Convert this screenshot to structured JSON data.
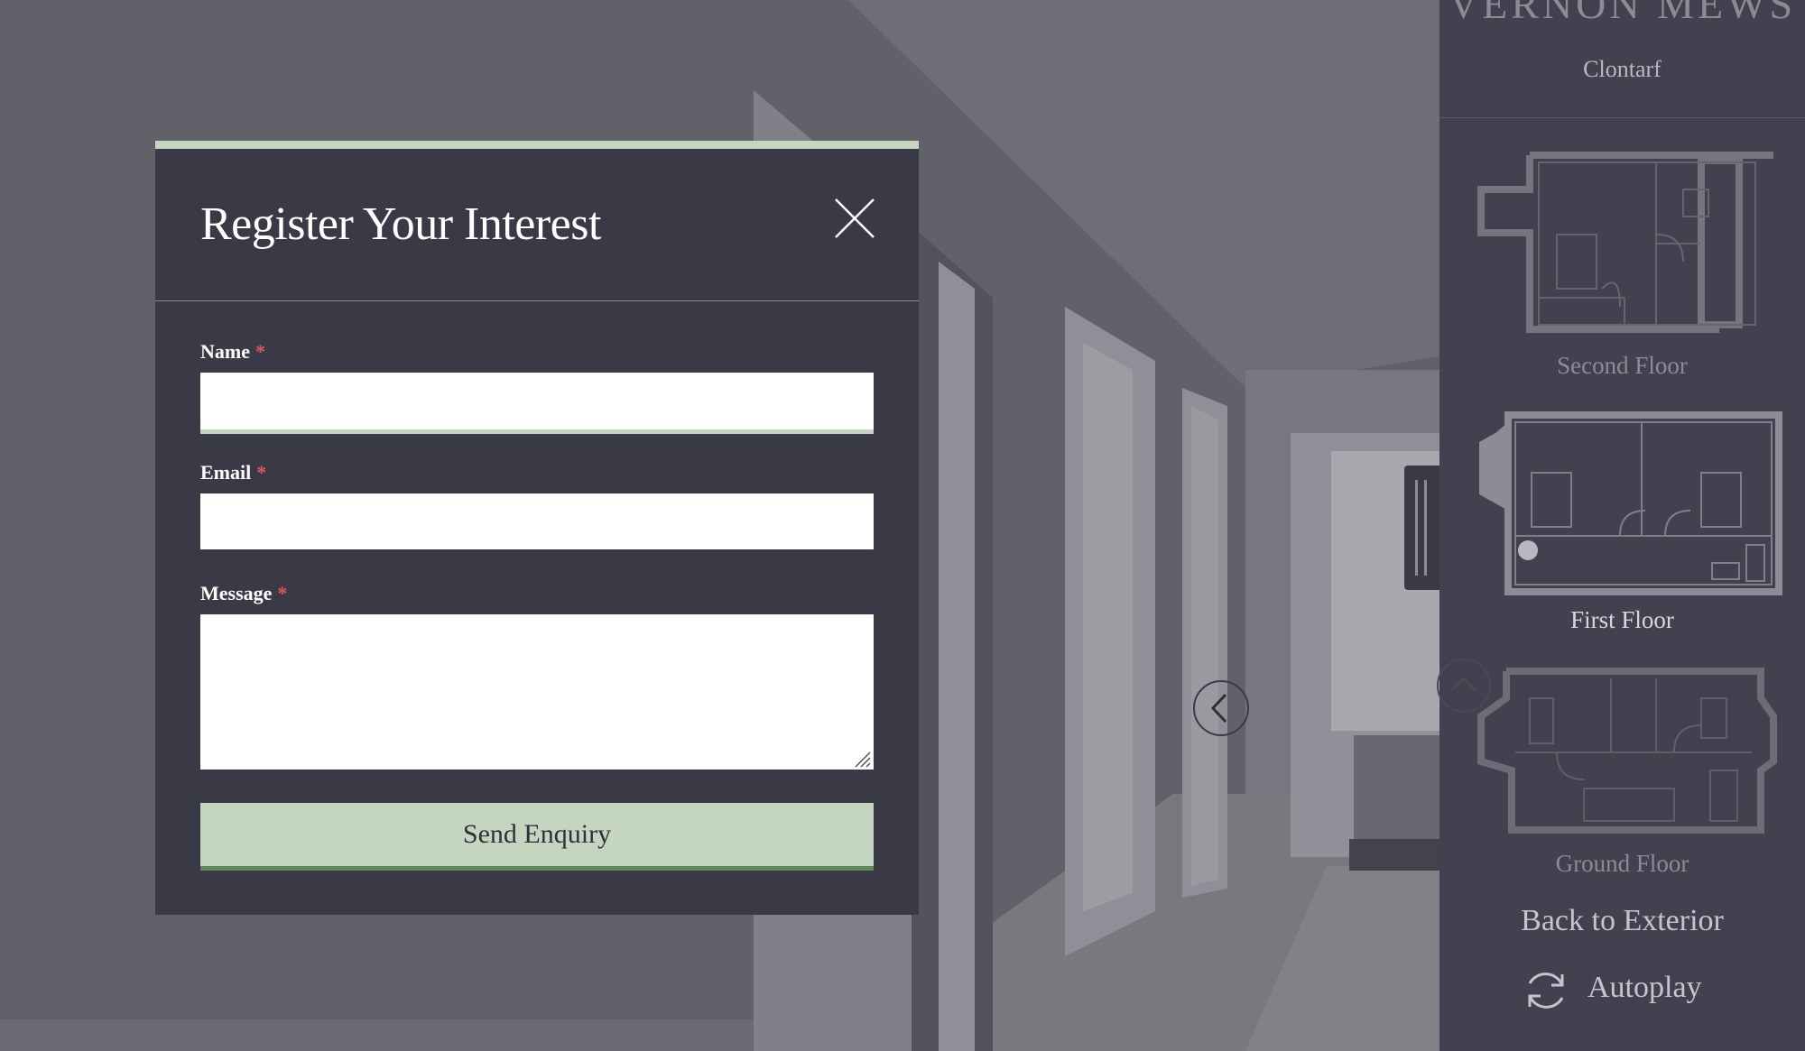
{
  "modal": {
    "title": "Register Your Interest",
    "fields": {
      "name": {
        "label": "Name",
        "required_mark": "*",
        "value": "",
        "placeholder": ""
      },
      "email": {
        "label": "Email",
        "required_mark": "*",
        "value": "",
        "placeholder": ""
      },
      "message": {
        "label": "Message",
        "required_mark": "*",
        "value": "",
        "placeholder": ""
      }
    },
    "submit_label": "Send Enquiry",
    "accent_color": "#c4d6bf"
  },
  "sidebar": {
    "development_name": "VERNON MEWS",
    "location": "Clontarf",
    "floors": [
      {
        "label": "Second Floor",
        "active": false
      },
      {
        "label": "First Floor",
        "active": true
      },
      {
        "label": "Ground Floor",
        "active": false
      }
    ],
    "back_label": "Back to Exterior",
    "autoplay_label": "Autoplay"
  },
  "icons": {
    "close": "close-icon",
    "autoplay": "refresh-icon",
    "nav_left": "chevron-left-icon",
    "nav_up": "chevron-up-icon",
    "location_marker": "position-dot-icon"
  }
}
